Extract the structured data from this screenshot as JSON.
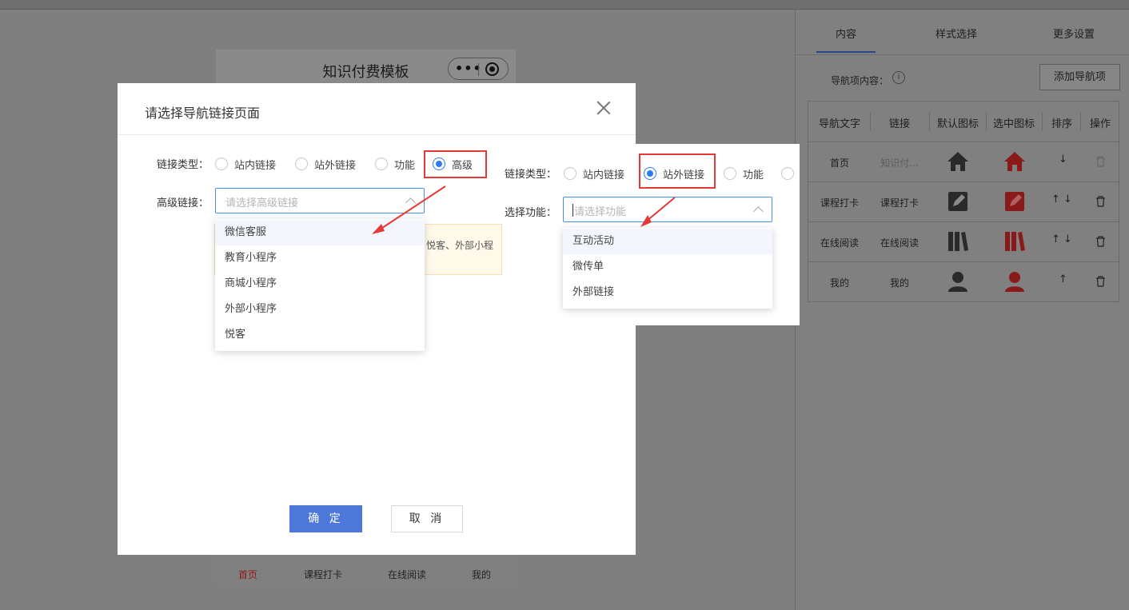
{
  "phone": {
    "title": "知识付费模板",
    "tabbar": [
      "首页",
      "课程打卡",
      "在线阅读",
      "我的"
    ]
  },
  "panel": {
    "tabs": [
      "内容",
      "样式选择",
      "更多设置"
    ],
    "active_tab": "内容",
    "nav_label": "导航项内容：",
    "info_icon": "i",
    "add_button": "添加导航项",
    "table": {
      "headers": [
        "导航文字",
        "链接",
        "默认图标",
        "选中图标",
        "排序",
        "操作"
      ],
      "rows": [
        {
          "text": "首页",
          "link": "知识付...",
          "icon": "home-icon",
          "sort": "↓"
        },
        {
          "text": "课程打卡",
          "link": "课程打卡",
          "icon": "edit-icon",
          "sort": "↑ ↓"
        },
        {
          "text": "在线阅读",
          "link": "在线阅读",
          "icon": "books-icon",
          "sort": "↑ ↓"
        },
        {
          "text": "我的",
          "link": "我的",
          "icon": "user-icon",
          "sort": "↑"
        }
      ]
    }
  },
  "modal": {
    "title": "请选择导航链接页面",
    "link_type_label": "链接类型：",
    "link_types": [
      "站内链接",
      "站外链接",
      "功能",
      "高级"
    ],
    "selected_type": "高级",
    "advanced_label": "高级链接：",
    "advanced_placeholder": "请选择高级链接",
    "notice_text": "序、悦客、外部小程",
    "options": [
      "微信客服",
      "教育小程序",
      "商城小程序",
      "外部小程序",
      "悦客"
    ],
    "confirm": "确 定",
    "cancel": "取 消"
  },
  "callout": {
    "link_type_label": "链接类型：",
    "link_types": [
      "站内链接",
      "站外链接",
      "功能"
    ],
    "selected_type": "站外链接",
    "function_label": "选择功能：",
    "function_placeholder": "请选择功能",
    "options": [
      "互动活动",
      "微传单",
      "外部链接"
    ]
  },
  "colors": {
    "primary": "#4d77d8",
    "radio_checked": "#2d7bf4",
    "highlight": "#e53935",
    "icon_active": "#e02424"
  }
}
